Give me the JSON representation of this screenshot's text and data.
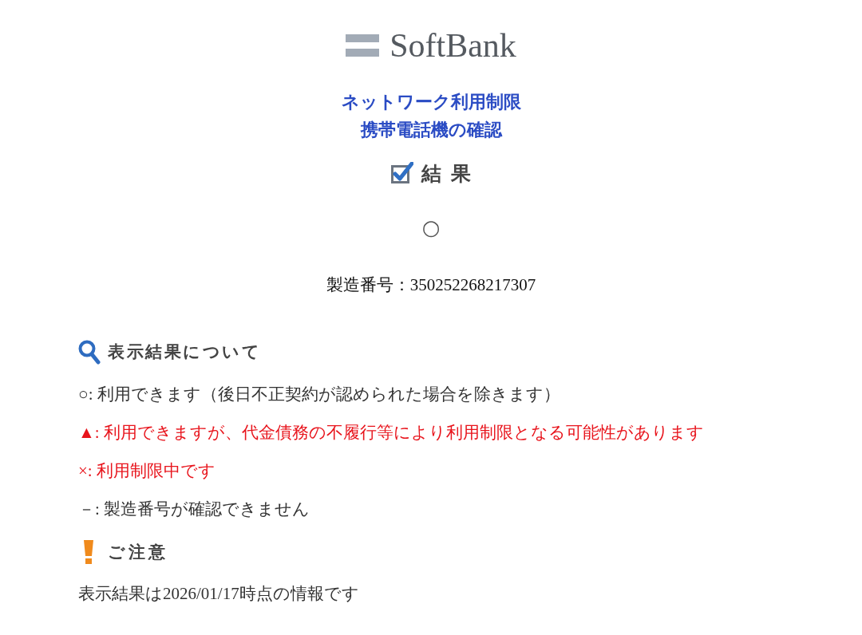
{
  "header": {
    "logo_text": "SoftBank"
  },
  "title_lines": [
    "ネットワーク利用制限",
    "携帯電話機の確認"
  ],
  "result": {
    "heading": "結果",
    "mark": "○",
    "serial": "製造番号：350252268217307"
  },
  "legend": {
    "heading": "表示結果について",
    "items": [
      {
        "text": "○: 利用できます（後日不正契約が認められた場合を除きます）",
        "color": "#333333"
      },
      {
        "text": "▲: 利用できますが、代金債務の不履行等により利用制限となる可能性があります",
        "color": "#e8141c"
      },
      {
        "text": "×: 利用制限中です",
        "color": "#e8141c"
      },
      {
        "text": "－: 製造番号が確認できません",
        "color": "#333333"
      }
    ]
  },
  "notice": {
    "heading": "ご注意",
    "text": "表示結果は2026/01/17時点の情報です"
  }
}
